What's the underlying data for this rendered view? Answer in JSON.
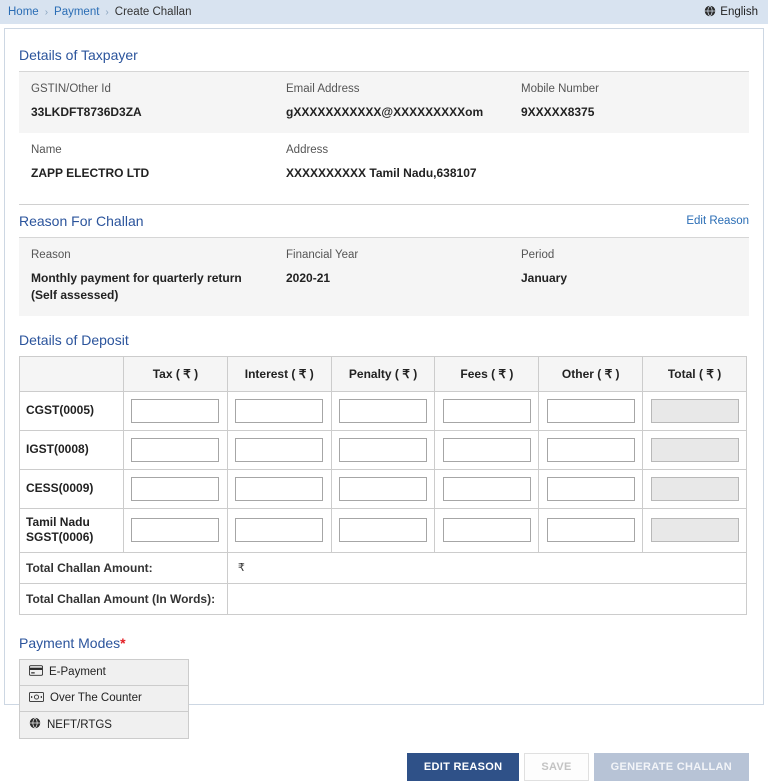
{
  "breadcrumb": {
    "items": [
      "Home",
      "Payment",
      "Create Challan"
    ],
    "language": "English"
  },
  "taxpayer": {
    "title": "Details of Taxpayer",
    "gstin": {
      "label": "GSTIN/Other Id",
      "value": "33LKDFT8736D3ZA"
    },
    "email": {
      "label": "Email Address",
      "value": "gXXXXXXXXXXX@XXXXXXXXXom"
    },
    "mobile": {
      "label": "Mobile Number",
      "value": "9XXXXX8375"
    },
    "name": {
      "label": "Name",
      "value": "ZAPP ELECTRO LTD"
    },
    "address": {
      "label": "Address",
      "value": "XXXXXXXXXX Tamil Nadu,638107"
    }
  },
  "reason": {
    "title": "Reason For Challan",
    "edit_link": "Edit Reason",
    "reason": {
      "label": "Reason",
      "value": "Monthly payment for quarterly return (Self assessed)"
    },
    "financial_year": {
      "label": "Financial Year",
      "value": "2020-21"
    },
    "period": {
      "label": "Period",
      "value": "January"
    }
  },
  "deposit": {
    "title": "Details of Deposit",
    "columns": [
      "Tax ( ₹ )",
      "Interest ( ₹ )",
      "Penalty ( ₹ )",
      "Fees ( ₹ )",
      "Other ( ₹ )",
      "Total ( ₹ )"
    ],
    "rows": [
      {
        "label": "CGST(0005)"
      },
      {
        "label": "IGST(0008)"
      },
      {
        "label": "CESS(0009)"
      },
      {
        "label": "Tamil Nadu SGST(0006)"
      }
    ],
    "total_label": "Total Challan Amount:",
    "total_value": "₹",
    "total_words_label": "Total Challan Amount (In Words):",
    "total_words_value": ""
  },
  "payment_modes": {
    "title": "Payment Modes",
    "required_marker": "*",
    "options": [
      {
        "label": "E-Payment",
        "icon": "credit-card-icon"
      },
      {
        "label": "Over The Counter",
        "icon": "cash-icon"
      },
      {
        "label": "NEFT/RTGS",
        "icon": "globe-icon"
      }
    ]
  },
  "actions": {
    "edit_reason": "EDIT REASON",
    "save": "SAVE",
    "generate_challan": "GENERATE CHALLAN"
  },
  "colors": {
    "topbar_bg": "#d8e3f0",
    "link_blue": "#2a6db5",
    "heading_blue": "#2b549c",
    "primary_button": "#2f5188",
    "disabled_button": "#b7c3d6",
    "required_red": "#e31e24",
    "panel_gray": "#f5f5f5"
  }
}
